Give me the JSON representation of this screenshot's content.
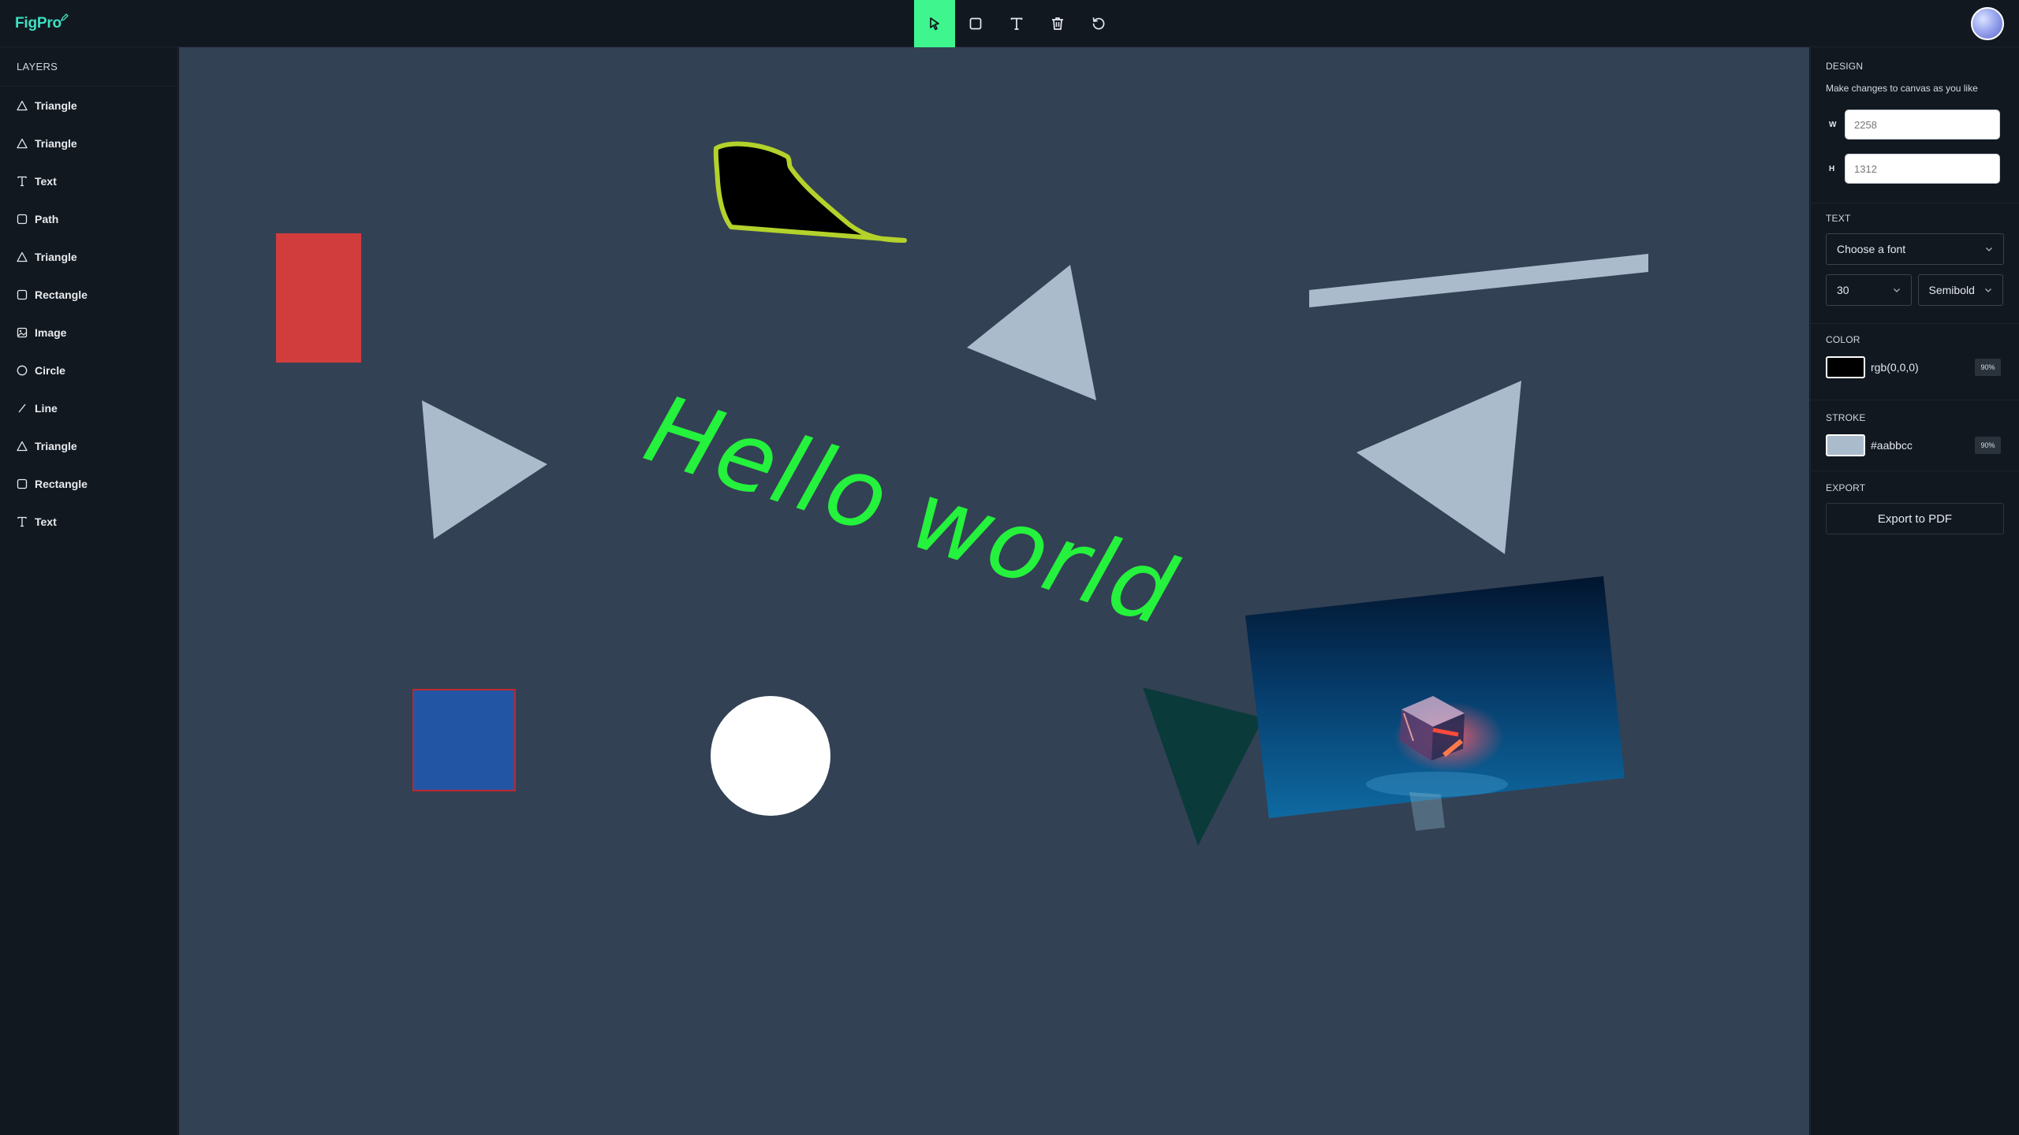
{
  "app": {
    "logo": "FigPro"
  },
  "toolbar": {
    "tools": [
      {
        "name": "select",
        "icon": "cursor-icon",
        "active": true
      },
      {
        "name": "rectangle",
        "icon": "square-icon",
        "active": false
      },
      {
        "name": "text",
        "icon": "text-icon",
        "active": false
      },
      {
        "name": "delete",
        "icon": "trash-icon",
        "active": false
      },
      {
        "name": "reset",
        "icon": "refresh-icon",
        "active": false
      }
    ],
    "accent": "#3ef58e"
  },
  "layers": {
    "title": "LAYERS",
    "items": [
      {
        "label": "Triangle",
        "icon": "triangle-icon"
      },
      {
        "label": "Triangle",
        "icon": "triangle-icon"
      },
      {
        "label": "Text",
        "icon": "text-icon"
      },
      {
        "label": "Path",
        "icon": "square-icon"
      },
      {
        "label": "Triangle",
        "icon": "triangle-icon"
      },
      {
        "label": "Rectangle",
        "icon": "square-icon"
      },
      {
        "label": "Image",
        "icon": "image-icon"
      },
      {
        "label": "Circle",
        "icon": "circle-icon"
      },
      {
        "label": "Line",
        "icon": "line-icon"
      },
      {
        "label": "Triangle",
        "icon": "triangle-icon"
      },
      {
        "label": "Rectangle",
        "icon": "square-icon"
      },
      {
        "label": "Text",
        "icon": "text-icon"
      }
    ]
  },
  "canvas": {
    "background": "#334154",
    "text_object": "Hello world",
    "colors": {
      "red_rect": "#d13d3d",
      "blue_rect": "#2355a5",
      "blue_rect_stroke": "#c0262f",
      "triangles": "#aabbcc",
      "dark_triangle": "#0a3a3a",
      "text": "#24f23c",
      "path_stroke": "#b3d22b",
      "circle": "#ffffff"
    }
  },
  "design": {
    "title": "DESIGN",
    "subtitle": "Make changes to canvas as you like",
    "width_label": "W",
    "width_placeholder": "2258",
    "height_label": "H",
    "height_placeholder": "1312",
    "text_title": "TEXT",
    "font_select": "Choose a font",
    "font_size": "30",
    "font_weight": "Semibold",
    "color_title": "COLOR",
    "color_value": "rgb(0,0,0)",
    "color_swatch": "#000000",
    "color_opacity": "90%",
    "stroke_title": "STROKE",
    "stroke_value": "#aabbcc",
    "stroke_swatch": "#aabbcc",
    "stroke_opacity": "90%",
    "export_title": "EXPORT",
    "export_button": "Export to PDF"
  }
}
